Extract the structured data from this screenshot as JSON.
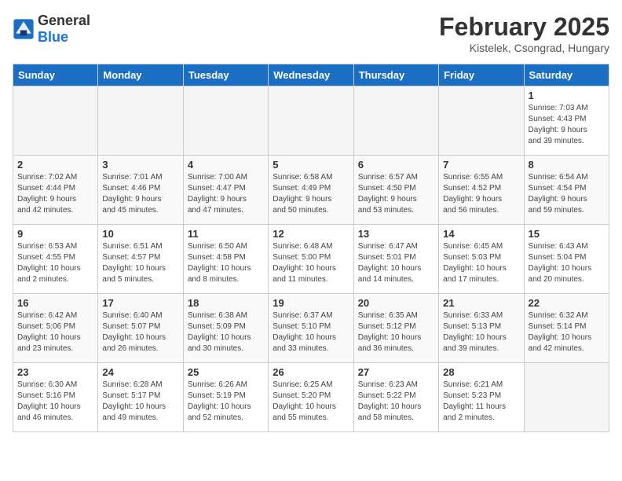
{
  "logo": {
    "text_general": "General",
    "text_blue": "Blue"
  },
  "header": {
    "title": "February 2025",
    "subtitle": "Kistelek, Csongrad, Hungary"
  },
  "weekdays": [
    "Sunday",
    "Monday",
    "Tuesday",
    "Wednesday",
    "Thursday",
    "Friday",
    "Saturday"
  ],
  "weeks": [
    [
      {
        "day": "",
        "info": ""
      },
      {
        "day": "",
        "info": ""
      },
      {
        "day": "",
        "info": ""
      },
      {
        "day": "",
        "info": ""
      },
      {
        "day": "",
        "info": ""
      },
      {
        "day": "",
        "info": ""
      },
      {
        "day": "1",
        "info": "Sunrise: 7:03 AM\nSunset: 4:43 PM\nDaylight: 9 hours\nand 39 minutes."
      }
    ],
    [
      {
        "day": "2",
        "info": "Sunrise: 7:02 AM\nSunset: 4:44 PM\nDaylight: 9 hours\nand 42 minutes."
      },
      {
        "day": "3",
        "info": "Sunrise: 7:01 AM\nSunset: 4:46 PM\nDaylight: 9 hours\nand 45 minutes."
      },
      {
        "day": "4",
        "info": "Sunrise: 7:00 AM\nSunset: 4:47 PM\nDaylight: 9 hours\nand 47 minutes."
      },
      {
        "day": "5",
        "info": "Sunrise: 6:58 AM\nSunset: 4:49 PM\nDaylight: 9 hours\nand 50 minutes."
      },
      {
        "day": "6",
        "info": "Sunrise: 6:57 AM\nSunset: 4:50 PM\nDaylight: 9 hours\nand 53 minutes."
      },
      {
        "day": "7",
        "info": "Sunrise: 6:55 AM\nSunset: 4:52 PM\nDaylight: 9 hours\nand 56 minutes."
      },
      {
        "day": "8",
        "info": "Sunrise: 6:54 AM\nSunset: 4:54 PM\nDaylight: 9 hours\nand 59 minutes."
      }
    ],
    [
      {
        "day": "9",
        "info": "Sunrise: 6:53 AM\nSunset: 4:55 PM\nDaylight: 10 hours\nand 2 minutes."
      },
      {
        "day": "10",
        "info": "Sunrise: 6:51 AM\nSunset: 4:57 PM\nDaylight: 10 hours\nand 5 minutes."
      },
      {
        "day": "11",
        "info": "Sunrise: 6:50 AM\nSunset: 4:58 PM\nDaylight: 10 hours\nand 8 minutes."
      },
      {
        "day": "12",
        "info": "Sunrise: 6:48 AM\nSunset: 5:00 PM\nDaylight: 10 hours\nand 11 minutes."
      },
      {
        "day": "13",
        "info": "Sunrise: 6:47 AM\nSunset: 5:01 PM\nDaylight: 10 hours\nand 14 minutes."
      },
      {
        "day": "14",
        "info": "Sunrise: 6:45 AM\nSunset: 5:03 PM\nDaylight: 10 hours\nand 17 minutes."
      },
      {
        "day": "15",
        "info": "Sunrise: 6:43 AM\nSunset: 5:04 PM\nDaylight: 10 hours\nand 20 minutes."
      }
    ],
    [
      {
        "day": "16",
        "info": "Sunrise: 6:42 AM\nSunset: 5:06 PM\nDaylight: 10 hours\nand 23 minutes."
      },
      {
        "day": "17",
        "info": "Sunrise: 6:40 AM\nSunset: 5:07 PM\nDaylight: 10 hours\nand 26 minutes."
      },
      {
        "day": "18",
        "info": "Sunrise: 6:38 AM\nSunset: 5:09 PM\nDaylight: 10 hours\nand 30 minutes."
      },
      {
        "day": "19",
        "info": "Sunrise: 6:37 AM\nSunset: 5:10 PM\nDaylight: 10 hours\nand 33 minutes."
      },
      {
        "day": "20",
        "info": "Sunrise: 6:35 AM\nSunset: 5:12 PM\nDaylight: 10 hours\nand 36 minutes."
      },
      {
        "day": "21",
        "info": "Sunrise: 6:33 AM\nSunset: 5:13 PM\nDaylight: 10 hours\nand 39 minutes."
      },
      {
        "day": "22",
        "info": "Sunrise: 6:32 AM\nSunset: 5:14 PM\nDaylight: 10 hours\nand 42 minutes."
      }
    ],
    [
      {
        "day": "23",
        "info": "Sunrise: 6:30 AM\nSunset: 5:16 PM\nDaylight: 10 hours\nand 46 minutes."
      },
      {
        "day": "24",
        "info": "Sunrise: 6:28 AM\nSunset: 5:17 PM\nDaylight: 10 hours\nand 49 minutes."
      },
      {
        "day": "25",
        "info": "Sunrise: 6:26 AM\nSunset: 5:19 PM\nDaylight: 10 hours\nand 52 minutes."
      },
      {
        "day": "26",
        "info": "Sunrise: 6:25 AM\nSunset: 5:20 PM\nDaylight: 10 hours\nand 55 minutes."
      },
      {
        "day": "27",
        "info": "Sunrise: 6:23 AM\nSunset: 5:22 PM\nDaylight: 10 hours\nand 58 minutes."
      },
      {
        "day": "28",
        "info": "Sunrise: 6:21 AM\nSunset: 5:23 PM\nDaylight: 11 hours\nand 2 minutes."
      },
      {
        "day": "",
        "info": ""
      }
    ]
  ]
}
